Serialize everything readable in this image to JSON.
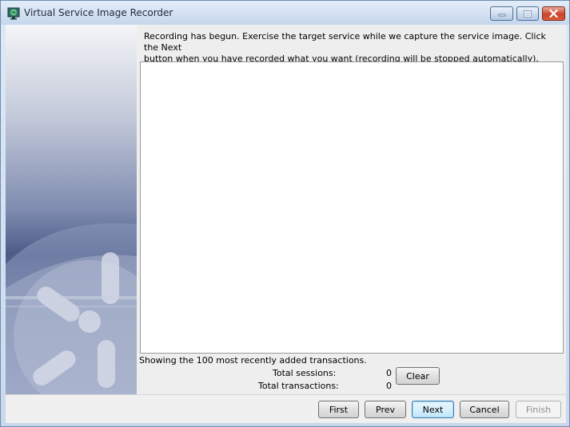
{
  "window": {
    "title": "Virtual Service Image Recorder",
    "app_icon": "monitor-globe-icon",
    "controls": {
      "minimize": "minimize-icon",
      "maximize": "maximize-icon",
      "close": "close-icon"
    }
  },
  "main": {
    "intro_text": "Recording has begun.  Exercise the target service while we capture the service image.  Click the Next\nbutton when you have recorded what you want (recording will be stopped automatically).",
    "showing_text": "Showing the 100 most recently added transactions.",
    "total_sessions_label": "Total sessions:",
    "total_sessions_value": "0",
    "total_transactions_label": "Total transactions:",
    "total_transactions_value": "0",
    "clear_label": "Clear"
  },
  "buttons": {
    "first": "First",
    "prev": "Prev",
    "next": "Next",
    "cancel": "Cancel",
    "finish": "Finish"
  },
  "colors": {
    "title_bar": "#c6d7ec",
    "close_button": "#c9452b",
    "focus_button": "#3c7fb1",
    "side_panel_dark": "#4b5a88",
    "side_panel_light": "#e1e4ec"
  }
}
